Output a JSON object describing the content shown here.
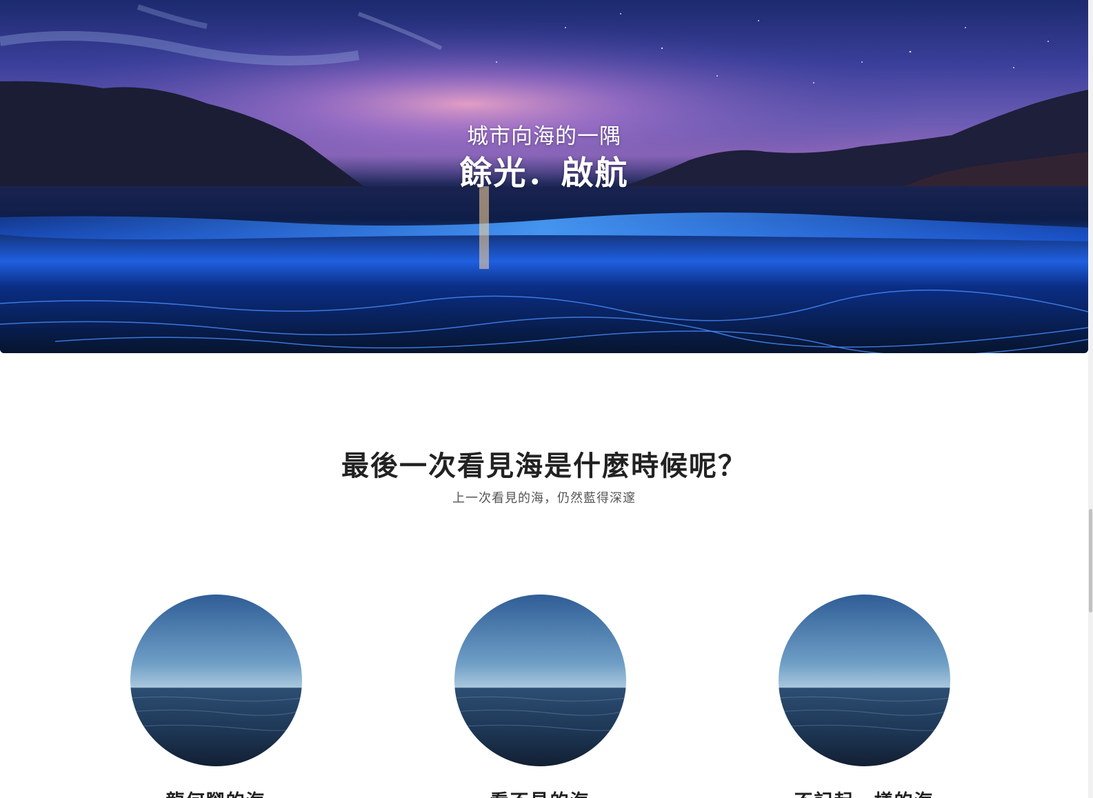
{
  "hero": {
    "subtitle": "城市向海的一隅",
    "title": "餘光．啟航"
  },
  "section": {
    "title": "最後一次看見海是什麼時候呢？",
    "subtitle": "上一次看見的海，仍然藍得深邃"
  },
  "cards": [
    {
      "title": "龍何腳的海"
    },
    {
      "title": "看不見的海"
    },
    {
      "title": "不記起一樣的海"
    }
  ],
  "colors": {
    "heading": "#222222",
    "subtext": "#555555",
    "sea_glow": "#2f7dff"
  }
}
